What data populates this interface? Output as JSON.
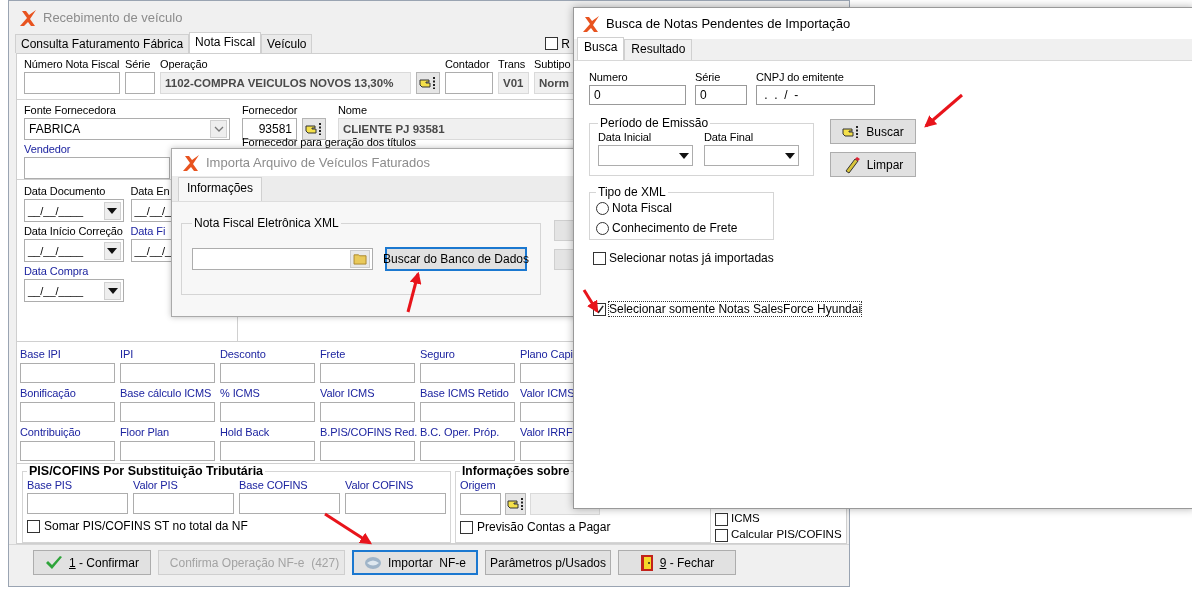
{
  "main_window": {
    "title": "Recebimento de veículo",
    "tabs": [
      {
        "label": "Consulta Faturamento Fábrica",
        "selected": false
      },
      {
        "label": "Nota Fiscal",
        "selected": true
      },
      {
        "label": "Veículo",
        "selected": false
      }
    ],
    "top_checkbox": {
      "label": "R",
      "checked": false
    },
    "invoice_fields": [
      {
        "label": "Número Nota Fiscal",
        "kind": "text"
      },
      {
        "label": "Série",
        "kind": "text"
      },
      {
        "label": "Operação",
        "kind": "readonly",
        "value": "1102-COMPRA VEICULOS NOVOS 13,30%",
        "lookup": true
      },
      {
        "label": "Contador",
        "kind": "text"
      },
      {
        "label": "Trans",
        "kind": "readonly",
        "value": "V01"
      },
      {
        "label": "Subtipo",
        "kind": "readonly",
        "value": "Norm"
      }
    ],
    "supplier_fields": [
      {
        "label": "Fonte Fornecedora",
        "kind": "combo",
        "value": "FABRICA"
      },
      {
        "label": "Fornecedor",
        "kind": "number",
        "value": "93581",
        "lookup": true
      },
      {
        "label": "Nome",
        "kind": "readonly",
        "value": "CLIENTE PJ 93581"
      }
    ],
    "vendor_label": "Vendedor",
    "titles_label": "Fornecedor para geração dos títulos",
    "dates": [
      [
        {
          "label": "Data Documento",
          "link": false,
          "value": "__/__/____"
        },
        {
          "label": "Data En",
          "link": false,
          "value": "__/__/_"
        }
      ],
      [
        {
          "label": "Data Início Correção",
          "link": false,
          "value": "__/__/____"
        },
        {
          "label": "Data Fi",
          "link": true,
          "value": "__/__/_"
        }
      ],
      [
        {
          "label": "Data Compra",
          "link": true,
          "value": "__/__/____"
        }
      ]
    ],
    "values": [
      [
        "Base IPI",
        "IPI",
        "Desconto",
        "Frete",
        "Seguro",
        "Plano Capi"
      ],
      [
        "Bonificação",
        "Base cálculo ICMS",
        "% ICMS",
        "Valor ICMS",
        "Base ICMS Retido",
        "Valor ICMS"
      ],
      [
        "Contribuição",
        "Floor Plan",
        "Hold Back",
        "B.PIS/COFINS Red.",
        "B.C. Oper. Próp.",
        "Valor IRRF"
      ]
    ],
    "pis_cofins": {
      "title": "PIS/COFINS Por Substituição Tributária",
      "fields": [
        "Base PIS",
        "Valor PIS",
        "Base COFINS",
        "Valor COFINS"
      ],
      "checkbox": {
        "label": "Somar PIS/COFINS ST no total da NF",
        "checked": false
      }
    },
    "info": {
      "title": "Informações sobre",
      "origin_label": "Origem",
      "checkbox": {
        "label": "Previsão Contas a Pagar",
        "checked": false
      }
    },
    "options": [
      {
        "label": "ICMS",
        "checked": false
      },
      {
        "label": "Calcular PIS/COFINS",
        "checked": false
      }
    ],
    "buttons": [
      {
        "label": "1 - Confirmar",
        "mnemonic": true,
        "disabled": false,
        "focused": false
      },
      {
        "label": "Confirma Operação NF-e  (427)",
        "mnemonic": false,
        "disabled": true,
        "focused": false
      },
      {
        "label": "Importar  NF-e",
        "mnemonic": false,
        "disabled": false,
        "focused": true
      },
      {
        "label": "Parâmetros p/Usados",
        "mnemonic": false,
        "disabled": false,
        "focused": false
      },
      {
        "label": "9 - Fechar",
        "mnemonic": true,
        "disabled": false,
        "focused": false
      }
    ]
  },
  "import_dialog": {
    "title": "Importa Arquivo de Veículos Faturados",
    "tabs": [
      {
        "label": "Informações",
        "selected": true
      }
    ],
    "group_title": "Nota Fiscal Eletrônica XML",
    "search_button": {
      "label": "Buscar do Banco de Dados",
      "focused": true
    }
  },
  "search_dialog": {
    "title": "Busca de Notas Pendentes de Importação",
    "tabs": [
      {
        "label": "Busca",
        "selected": true
      },
      {
        "label": "Resultado",
        "selected": false
      }
    ],
    "fields": [
      {
        "label": "Numero",
        "value": "0"
      },
      {
        "label": "Série",
        "value": "0"
      },
      {
        "label": "CNPJ do emitente",
        "value": " .  .  /  -"
      }
    ],
    "period": {
      "title": "Período de Emissão",
      "fields": [
        {
          "label": "Data Inicial"
        },
        {
          "label": "Data Final"
        }
      ]
    },
    "buttons": [
      {
        "label": "Buscar"
      },
      {
        "label": "Limpar"
      }
    ],
    "xml_type": {
      "title": "Tipo de XML",
      "options": [
        {
          "label": "Nota Fiscal",
          "selected": false
        },
        {
          "label": "Conhecimento de Frete",
          "selected": false
        }
      ]
    },
    "checkboxes": [
      {
        "label": "Selecionar notas já importadas",
        "checked": false,
        "focused": false
      },
      {
        "label": "Selecionar somente Notas SalesForce Hyundai",
        "checked": true,
        "focused": true
      }
    ]
  }
}
